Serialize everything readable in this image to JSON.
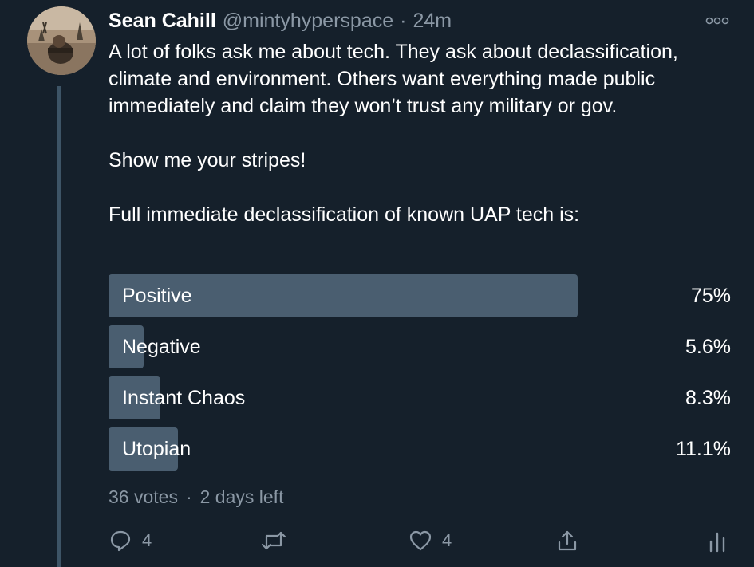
{
  "tweet": {
    "author_name": "Sean Cahill",
    "handle": "@mintyhyperspace",
    "separator": "·",
    "time": "24m",
    "more_icon": "more-dots-icon",
    "text_lines": [
      "A lot of folks ask me about tech. They ask about declassification, climate and environment. Others want everything made public immediately and claim they won’t trust any military or gov.",
      "Show me your stripes!",
      "Full immediate declassification of known UAP tech is:"
    ]
  },
  "poll": {
    "options": [
      {
        "label": "Positive",
        "percent_text": "75%",
        "fraction": 0.75
      },
      {
        "label": "Negative",
        "percent_text": "5.6%",
        "fraction": 0.056
      },
      {
        "label": "Instant Chaos",
        "percent_text": "8.3%",
        "fraction": 0.083
      },
      {
        "label": "Utopian",
        "percent_text": "11.1%",
        "fraction": 0.111
      }
    ],
    "votes": "36 votes",
    "separator": "·",
    "time_left": "2 days left"
  },
  "actions": {
    "reply_icon": "reply-icon",
    "reply_count": "4",
    "retweet_icon": "retweet-icon",
    "like_icon": "heart-icon",
    "like_count": "4",
    "share_icon": "share-icon",
    "analytics_icon": "analytics-icon"
  },
  "colors": {
    "background": "#15202b",
    "poll_bar": "#4a5e70",
    "secondary_text": "#8b98a5",
    "thread_line": "#3d5466"
  }
}
